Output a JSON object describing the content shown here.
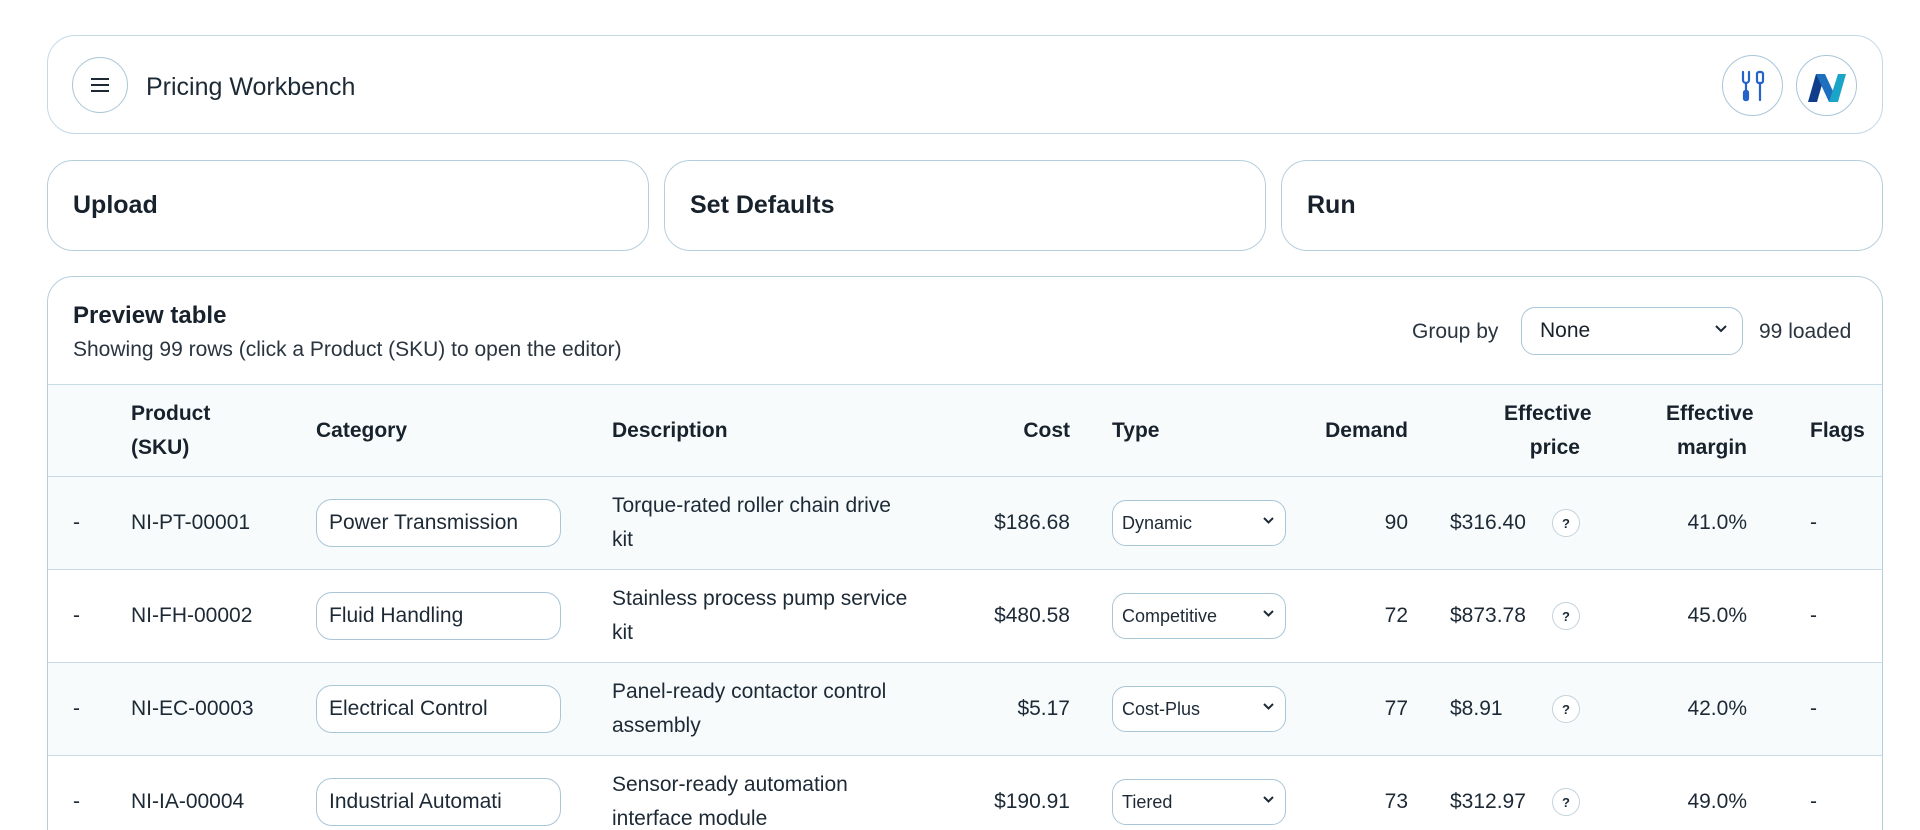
{
  "header": {
    "title": "Pricing Workbench"
  },
  "steps": [
    {
      "label": "Upload"
    },
    {
      "label": "Set Defaults"
    },
    {
      "label": "Run"
    }
  ],
  "preview": {
    "title": "Preview table",
    "subtitle": "Showing 99 rows (click a Product (SKU) to open the editor)",
    "group_by_label": "Group by",
    "group_by_value": "None",
    "loaded_text": "99 loaded"
  },
  "table": {
    "columns": {
      "sku": "Product (SKU)",
      "category": "Category",
      "description": "Description",
      "cost": "Cost",
      "type": "Type",
      "demand": "Demand",
      "effective_price": "Effective price",
      "effective_margin": "Effective margin",
      "flags": "Flags"
    },
    "rows": [
      {
        "select": "-",
        "sku": "NI-PT-00001",
        "category": "Power Transmission",
        "description": "Torque-rated roller chain drive kit",
        "cost": "$186.68",
        "type": "Dynamic",
        "demand": "90",
        "price": "$316.40",
        "help": "?",
        "margin": "41.0%",
        "flags": "-"
      },
      {
        "select": "-",
        "sku": "NI-FH-00002",
        "category": "Fluid Handling",
        "description": "Stainless process pump service kit",
        "cost": "$480.58",
        "type": "Competitive",
        "demand": "72",
        "price": "$873.78",
        "help": "?",
        "margin": "45.0%",
        "flags": "-"
      },
      {
        "select": "-",
        "sku": "NI-EC-00003",
        "category": "Electrical Control",
        "description": "Panel-ready contactor control assembly",
        "cost": "$5.17",
        "type": "Cost-Plus",
        "demand": "77",
        "price": "$8.91",
        "help": "?",
        "margin": "42.0%",
        "flags": "-"
      },
      {
        "select": "-",
        "sku": "NI-IA-00004",
        "category": "Industrial Automati",
        "description": "Sensor-ready automation interface module",
        "cost": "$190.91",
        "type": "Tiered",
        "demand": "73",
        "price": "$312.97",
        "help": "?",
        "margin": "49.0%",
        "flags": "-"
      }
    ]
  },
  "icons": {
    "menu": "hamburger-icon",
    "tools": "tools-icon",
    "avatar": "brand-logo-n",
    "chevron": "chevron-down-icon",
    "help": "question-icon"
  },
  "colors": {
    "border": "#b6cfdd",
    "tools_icon": "#2563c9",
    "logo_dark": "#0f3d8a",
    "logo_teal": "#1aa5c8"
  }
}
